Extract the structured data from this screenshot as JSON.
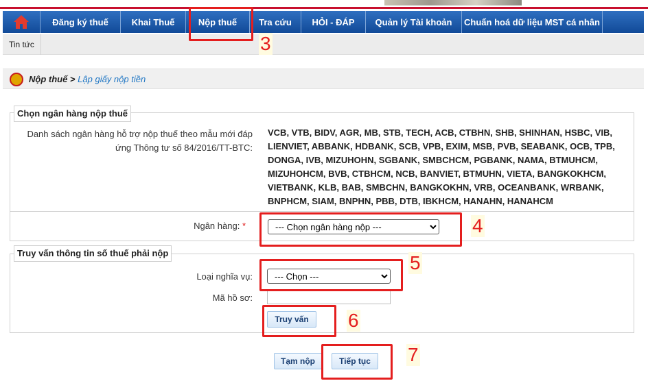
{
  "nav": {
    "home_icon": "home-icon",
    "items": [
      {
        "label": "Đăng ký thuế"
      },
      {
        "label": "Khai Thuế"
      },
      {
        "label": "Nộp thuế"
      },
      {
        "label": "Tra cứu"
      },
      {
        "label": "HỎI - ĐÁP"
      },
      {
        "label": "Quản lý Tài khoản"
      },
      {
        "label": "Chuẩn hoá dữ liệu MST cá nhân"
      }
    ]
  },
  "subnav": {
    "tab": "Tin tức"
  },
  "breadcrumb": {
    "current": "Nộp thuế >",
    "link": "Lập giấy nộp tiền"
  },
  "bank_section": {
    "legend": "Chọn ngân hàng nộp thuế",
    "list_label": "Danh sách ngân hàng hỗ trợ nộp thuế theo mẫu mới đáp ứng Thông tư số 84/2016/TT-BTC:",
    "bank_list": "VCB, VTB, BIDV, AGR, MB, STB, TECH, ACB, CTBHN, SHB, SHINHAN, HSBC, VIB, LIENVIET, ABBANK, HDBANK, SCB, VPB, EXIM, MSB, PVB, SEABANK, OCB, TPB, DONGA, IVB, MIZUHOHN, SGBANK, SMBCHCM, PGBANK, NAMA, BTMUHCM, MIZUHOHCM, BVB, CTBHCM, NCB, BANVIET, BTMUHN, VIETA, BANGKOKHCM, VIETBANK, KLB, BAB, SMBCHN, BANGKOKHN, VRB, OCEANBANK, WRBANK, BNPHCM, SIAM, BNPHN, PBB, DTB, IBKHCM, HANAHN, HANAHCM",
    "bank_label": "Ngân hàng:",
    "required_mark": "*",
    "bank_select": "--- Chọn ngân hàng nộp ---"
  },
  "query_section": {
    "legend": "Truy vấn thông tin số thuế phải nộp",
    "obligation_label": "Loại nghĩa vụ:",
    "obligation_select": "--- Chọn ---",
    "record_label": "Mã hồ sơ:",
    "record_value": "",
    "query_button": "Truy vấn"
  },
  "actions": {
    "temp_button": "Tạm nộp",
    "next_button": "Tiếp tục"
  },
  "annotations": [
    "3",
    "4",
    "5",
    "6",
    "7"
  ],
  "colors": {
    "nav": "#1a5aa8",
    "accent_red": "#e41e1e",
    "link": "#1f76c4"
  }
}
